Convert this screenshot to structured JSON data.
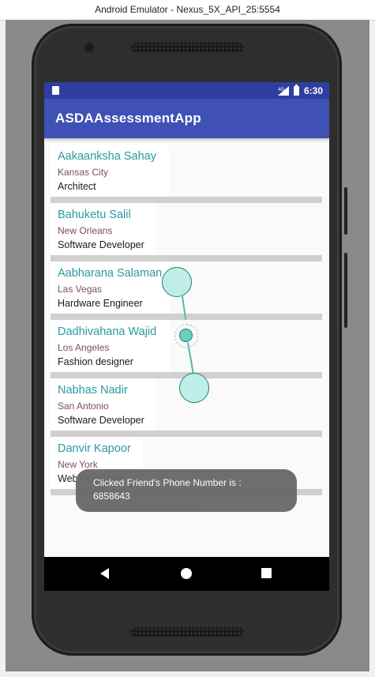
{
  "window": {
    "title": "Android Emulator - Nexus_5X_API_25:5554"
  },
  "status_bar": {
    "network": "4G",
    "time": "6:30"
  },
  "app_bar": {
    "title": "ASDAAssessmentApp"
  },
  "friends": [
    {
      "name": "Aakaanksha Sahay",
      "city": "Kansas City",
      "role": "Architect"
    },
    {
      "name": "Bahuketu Salil",
      "city": "New Orleans",
      "role": "Software Developer"
    },
    {
      "name": "Aabharana Salaman",
      "city": "Las Vegas",
      "role": "Hardware Engineer"
    },
    {
      "name": "Dadhivahana Wajid",
      "city": "Los Angeles",
      "role": "Fashion designer"
    },
    {
      "name": "Nabhas Nadir",
      "city": "San Antonio",
      "role": "Software Developer"
    },
    {
      "name": "Danvir Kapoor",
      "city": "New York",
      "role": "Web Developer"
    }
  ],
  "toast": {
    "line1": "Clicked Friend's Phone Number is :",
    "line2": "6858643"
  },
  "colors": {
    "status_bar": "#303f9f",
    "app_bar": "#3f51b5",
    "name_text": "#2a9aa0",
    "city_text": "#7b4a6a"
  }
}
